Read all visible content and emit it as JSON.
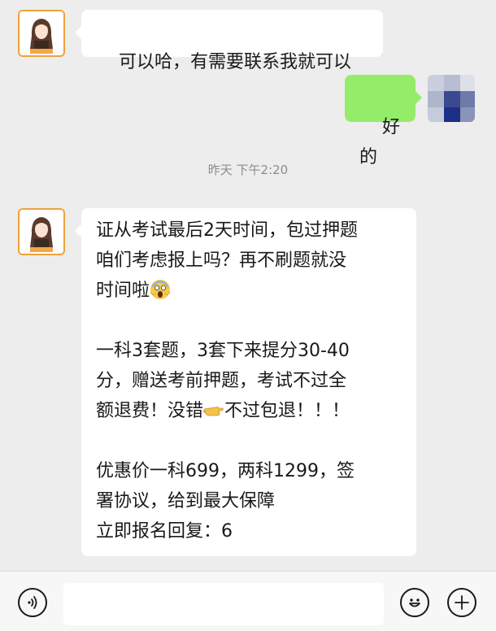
{
  "messages": [
    {
      "side": "left",
      "text": "可以哈，有需要联系我就可以"
    },
    {
      "side": "right",
      "text": "好的"
    }
  ],
  "timestamp": "昨天 下午2:20",
  "long_message": {
    "para1": [
      "证从考试最后2天时间，包过押题",
      "咱们考虑报上吗？再不刷题就没",
      "时间啦"
    ],
    "para2": [
      "一科3套题，3套下来提分30-40",
      "分，赠送考前押题，考试不过全",
      "额退费！没错",
      "不过包退！！！"
    ],
    "para3": [
      "优惠价一科699，两科1299，签",
      "署协议，给到最大保障",
      "立即报名回复：6"
    ]
  },
  "icons": {
    "voice": "voice-icon",
    "emoji": "smiley-icon",
    "add": "plus-icon",
    "scream": "scream-emoji",
    "pointing": "pointing-hand-emoji"
  },
  "colors": {
    "self_bubble": "#95ec69",
    "other_bubble": "#ffffff",
    "background": "#ededed",
    "avatar_border": "#f0a23a"
  }
}
